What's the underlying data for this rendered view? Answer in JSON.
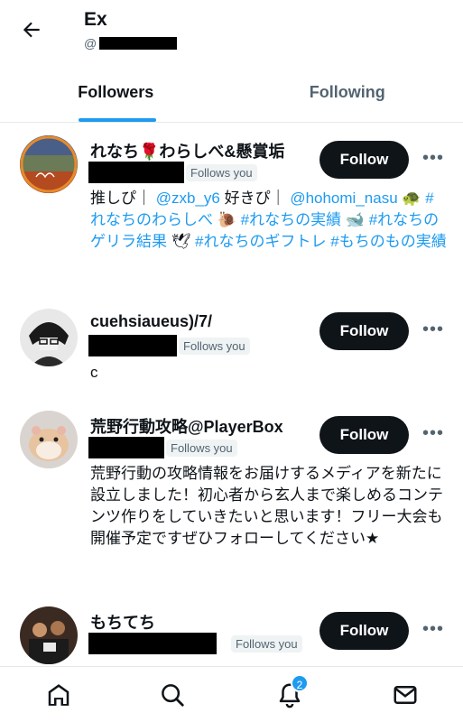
{
  "header": {
    "title": "Ex",
    "handle_prefix": "@"
  },
  "tabs": [
    {
      "label": "Followers",
      "active": true
    },
    {
      "label": "Following",
      "active": false
    }
  ],
  "accounts": [
    {
      "name": "れなち🌹わらしべ&懸賞垢",
      "badge": "Follows you",
      "button": "Follow",
      "more": "•••",
      "bio": {
        "t1": "推しぴ｜ ",
        "l1": "@zxb_y6",
        "t2": " 好きぴ｜ ",
        "l2": "@hohomi_nasu",
        "t3": " 🐢 ",
        "l3": "#れなちのわらしべ",
        "t4": " 🐌 ",
        "l4": "#れなちの実績",
        "t5": " 🐋 ",
        "l5": "#れなちのゲリラ結果",
        "t6": " 🕊 ",
        "l6": "#れなちのギフトレ",
        "t7": " ",
        "l7": "#もちのもの実績"
      }
    },
    {
      "name": "cuehsiaueus)/7/",
      "badge": "Follows you",
      "button": "Follow",
      "more": "•••",
      "bio": {
        "text": "c"
      }
    },
    {
      "name": "荒野行動攻略@PlayerBox",
      "badge": "Follows you",
      "button": "Follow",
      "more": "•••",
      "bio": {
        "text": "荒野行動の攻略情報をお届けするメディアを新たに設立しました！初心者から玄人まで楽しめるコンテンツ作りをしていきたいと思います！フリー大会も開催予定ですぜひフォローしてください★"
      }
    },
    {
      "name": "もちてち",
      "badge": "Follows you",
      "button": "Follow",
      "more": "•••",
      "bio": {
        "text": ""
      }
    }
  ],
  "bottom_nav": {
    "items": [
      "home-icon",
      "search-icon",
      "notifications-icon",
      "messages-icon"
    ],
    "notification_count": "2"
  },
  "colors": {
    "accent": "#1d9bf0",
    "text": "#0f1419",
    "secondary": "#536471",
    "button": "#0f1419"
  }
}
